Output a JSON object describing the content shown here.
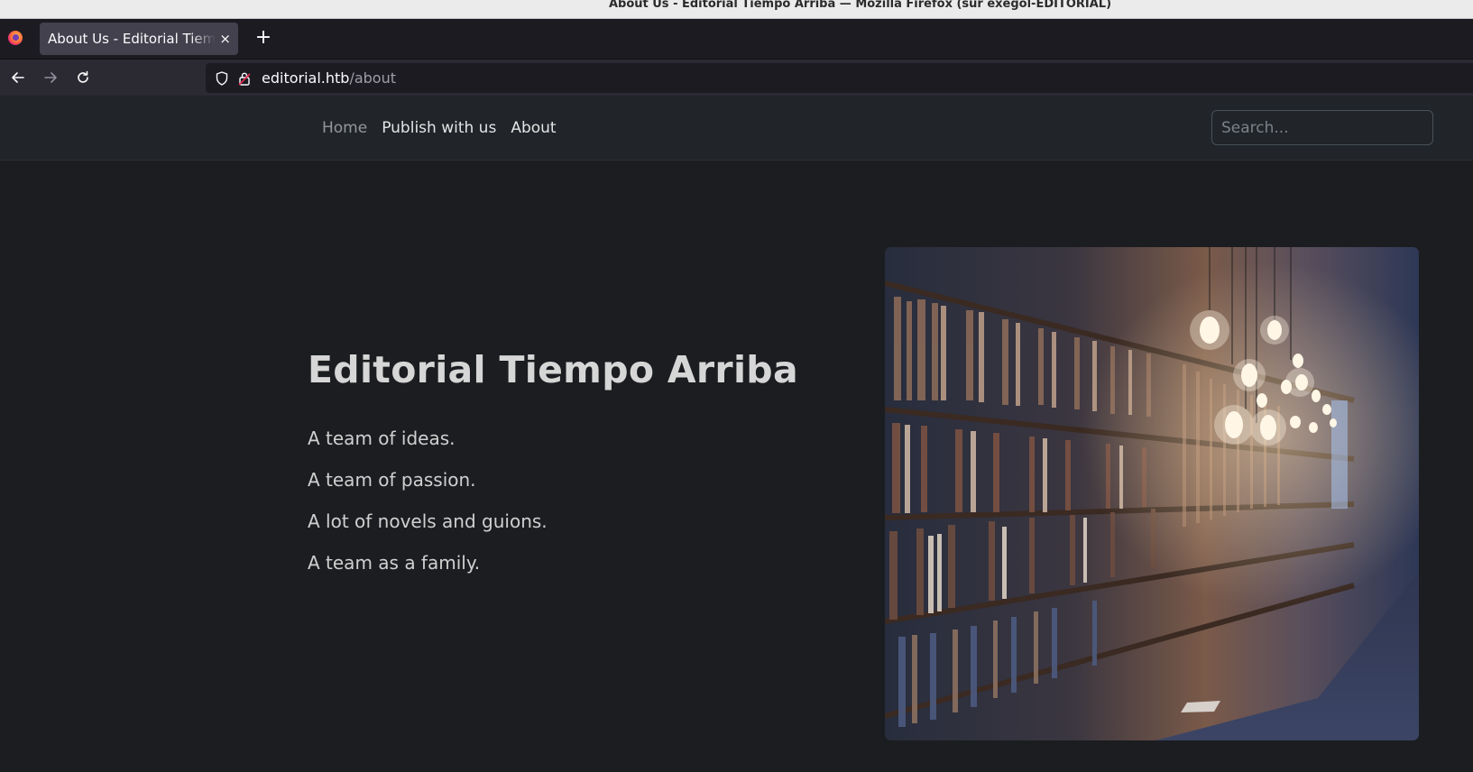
{
  "window": {
    "title": "About Us - Editorial Tiempo Arriba — Mozilla Firefox (sur exegol-EDITORIAL)"
  },
  "browser": {
    "tab_title": "About Us - Editorial Tiempo Arriba",
    "tab_close": "×",
    "new_tab": "+",
    "url_host": "editorial.htb",
    "url_path": "/about"
  },
  "site": {
    "nav": {
      "home": "Home",
      "publish": "Publish with us",
      "about": "About"
    },
    "search": {
      "placeholder": "Search..."
    }
  },
  "content": {
    "heading": "Editorial Tiempo Arriba",
    "lines": [
      "A team of ideas.",
      "A team of passion.",
      "A lot of novels and guions.",
      "A team as a family."
    ]
  },
  "image": {
    "subject": "library bookshelves with hanging light bulbs"
  },
  "colors": {
    "page_bg": "#1b1d20",
    "header_bg": "#212529",
    "browser_chrome": "#1c1b22"
  }
}
